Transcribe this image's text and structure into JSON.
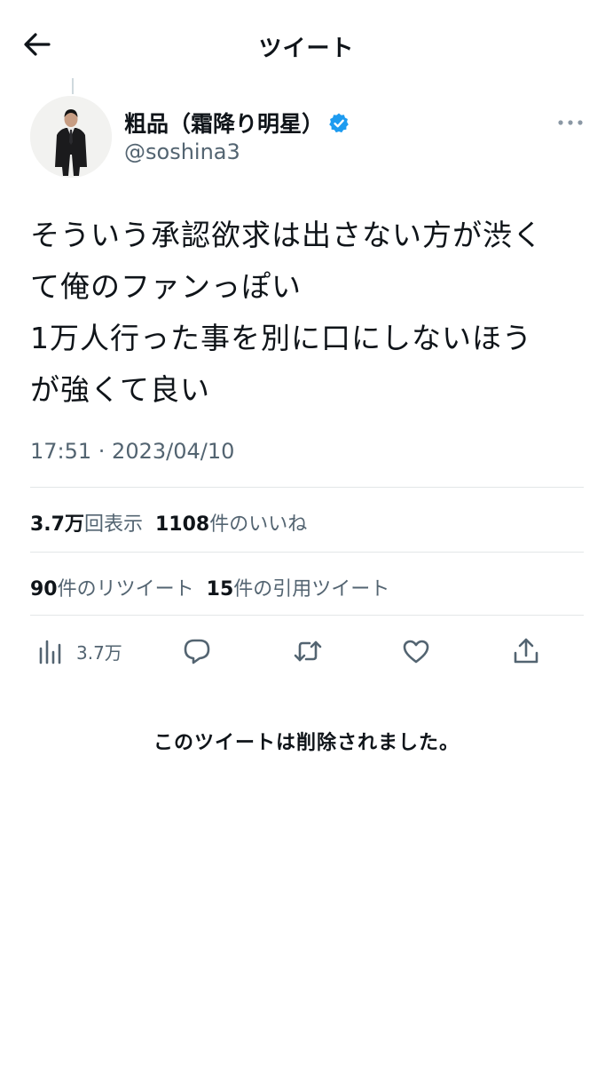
{
  "header": {
    "title": "ツイート",
    "back_icon": "arrow-left-icon"
  },
  "author": {
    "display_name": "粗品（霜降り明星）",
    "handle": "@soshina3",
    "verified": true
  },
  "tweet": {
    "lines": [
      "そういう承認欲求は出さない方が渋く",
      "て俺のファンっぽい",
      "1万人行った事を別に口にしないほう",
      "が強くて良い"
    ],
    "timestamp": "17:51 · 2023/04/10"
  },
  "stats": {
    "views_value": "3.7万",
    "views_label": "回表示",
    "likes_value": "1108",
    "likes_label": "件のいいね",
    "retweets_value": "90",
    "retweets_label": "件のリツイート",
    "quotes_value": "15",
    "quotes_label": "件の引用ツイート"
  },
  "actions": {
    "views_count": "3.7万",
    "icons": [
      "analytics-icon",
      "reply-icon",
      "retweet-icon",
      "like-icon",
      "share-icon"
    ]
  },
  "notice": "このツイートは削除されました。",
  "colors": {
    "text": "#0f1419",
    "secondary": "#536471",
    "divider": "#e3e6e8",
    "verified": "#1d9bf0"
  }
}
